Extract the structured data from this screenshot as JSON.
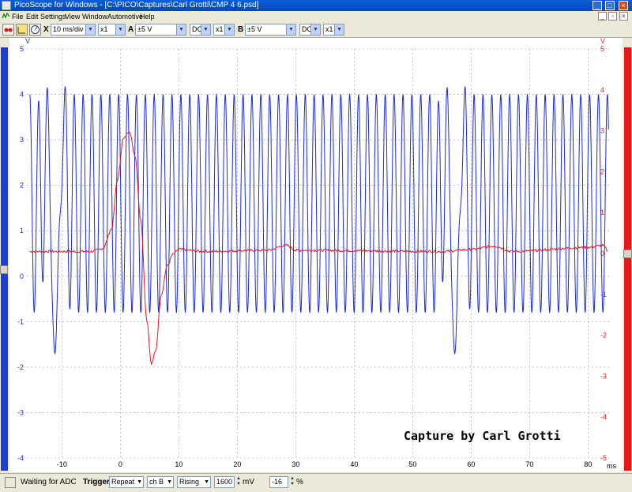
{
  "window": {
    "title": "PicoScope for Windows - [C:\\PICO\\Captures\\Carl Grotti\\CMP 4 6.psd]",
    "app_icon": "picoscope-app-icon",
    "minimize_glyph": "_",
    "maximize_glyph": "□",
    "close_glyph": "×"
  },
  "menu": {
    "items": [
      "File",
      "Edit",
      "Settings",
      "View",
      "Window",
      "Automotive",
      "Help"
    ],
    "mdi_glyphs": [
      "_",
      "▫",
      "×"
    ]
  },
  "toolbar": {
    "icons": [
      "channel-toggle-icon",
      "ruler-icon",
      "stopwatch-icon"
    ],
    "timebase_label": "X",
    "timebase": "10 ms/div",
    "x_multiplier": "x1",
    "channel_a_label": "A",
    "channel_a_range": "±5 V",
    "channel_a_coupling": "DC",
    "channel_a_multiplier": "x1",
    "channel_b_label": "B",
    "channel_b_range": "±5 V",
    "channel_b_coupling": "DC",
    "channel_b_multiplier": "x1",
    "dropdown_arrow": "▼"
  },
  "statusbar": {
    "status": "Waiting for ADC",
    "trigger_label": "Trigger",
    "trigger_mode": "Repeat",
    "trigger_channel": "ch B",
    "trigger_edge": "Rising",
    "threshold": "1600",
    "threshold_unit": "mV",
    "pretrigger": "-16",
    "pretrigger_unit": "%",
    "spin_up": "▲",
    "spin_down": "▼"
  },
  "colors": {
    "channel_a": "#1a2bd8",
    "channel_b": "#e81818",
    "grid": "#9a9a9a"
  },
  "chart_data": {
    "type": "line",
    "annotation": "Capture by Carl Grotti",
    "xlabel": "ms",
    "left_axis_unit": "V",
    "right_axis_unit": "V",
    "xlim": [
      -16,
      84
    ],
    "x_ticks": [
      -10,
      0,
      10,
      20,
      30,
      40,
      50,
      60,
      70,
      80
    ],
    "left_ylim": [
      -4,
      5
    ],
    "left_ticks": [
      5,
      4,
      3,
      2,
      1,
      0,
      -1,
      -2,
      -3,
      -4
    ],
    "right_ylim": [
      -5,
      5
    ],
    "right_ticks": [
      5,
      4,
      3,
      2,
      1,
      0,
      -1,
      -2,
      -3,
      -4,
      -5
    ],
    "grid": true,
    "series": [
      {
        "channel": "A",
        "color": "#1a2bd8",
        "axis": "left",
        "description_points": "crank sensor AC sine; ~4.0 V peaks, ~-0.8 V troughs, period ~1.5 ms; gap at -11 ms and 58 ms",
        "period_ms": 1.52,
        "peak_v": 4.0,
        "trough_v": -0.8,
        "gap_events_ms": [
          -11.2,
          57.2
        ],
        "gap_peak_v": 4.9,
        "gap_trough_v": -1.7,
        "x_start": -15.5,
        "x_end": 83.5
      },
      {
        "channel": "B",
        "color": "#e81818",
        "axis": "right",
        "baseline_v": 0.05,
        "points": [
          [
            -15.5,
            0.05
          ],
          [
            -5,
            0.05
          ],
          [
            -3,
            0.12
          ],
          [
            -1.5,
            0.6
          ],
          [
            -0.5,
            1.8
          ],
          [
            0.5,
            2.8
          ],
          [
            1.5,
            3.0
          ],
          [
            2.5,
            2.4
          ],
          [
            3.5,
            0.8
          ],
          [
            4.5,
            -1.6
          ],
          [
            5.3,
            -2.7
          ],
          [
            6.0,
            -2.4
          ],
          [
            7.0,
            -1.0
          ],
          [
            8.0,
            -0.3
          ],
          [
            9.0,
            -0.02
          ],
          [
            10.0,
            0.1
          ],
          [
            14.0,
            0.05
          ],
          [
            25.0,
            0.08
          ],
          [
            28.5,
            0.2
          ],
          [
            30.0,
            0.08
          ],
          [
            55.0,
            0.05
          ],
          [
            60.0,
            0.1
          ],
          [
            64.0,
            0.18
          ],
          [
            67.0,
            0.05
          ],
          [
            80.0,
            0.15
          ],
          [
            82.5,
            0.2
          ],
          [
            83.5,
            0.05
          ]
        ]
      }
    ]
  }
}
